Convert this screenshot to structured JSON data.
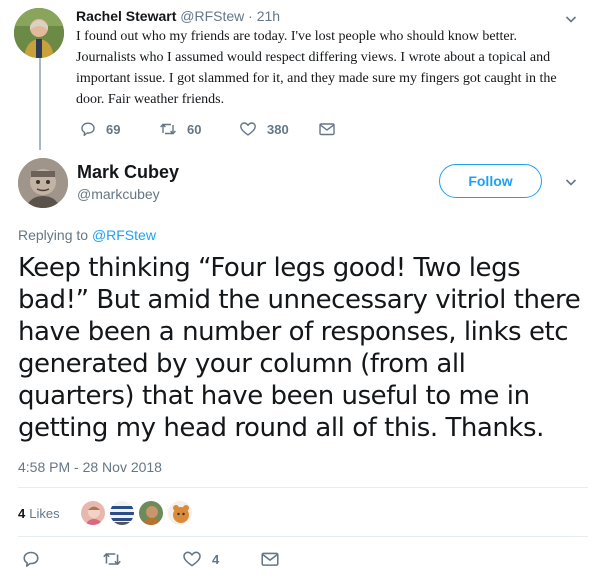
{
  "parent_tweet": {
    "name": "Rachel Stewart",
    "handle": "@RFStew",
    "separator": "·",
    "time": "21h",
    "text": "I found out who my friends are today. I've lost people who should know better. Journalists who I assumed would respect differing views. I wrote about a topical and important issue. I got slammed for it, and they made sure my fingers got caught in the door. Fair weather friends.",
    "replies": "69",
    "retweets": "60",
    "likes": "380"
  },
  "main_tweet": {
    "name": "Mark Cubey",
    "handle": "@markcubey",
    "follow_label": "Follow",
    "replying_prefix": "Replying to",
    "replying_to": "@RFStew",
    "text": "Keep thinking “Four legs good! Two legs bad!” But amid the unnecessary vitriol there have been a number of responses, links etc generated by your column (from all quarters) that have been useful to me in getting my head round all of this. Thanks.",
    "timestamp": "4:58 PM - 28 Nov 2018",
    "likes_count": "4",
    "likes_label": "Likes",
    "action_like_count": "4"
  },
  "colors": {
    "accent": "#1da1f2",
    "muted": "#657786",
    "text": "#14171a",
    "divider": "#e6ecf0"
  },
  "icons": [
    "reply-icon",
    "retweet-icon",
    "like-icon",
    "message-icon",
    "chevron-down-icon"
  ]
}
